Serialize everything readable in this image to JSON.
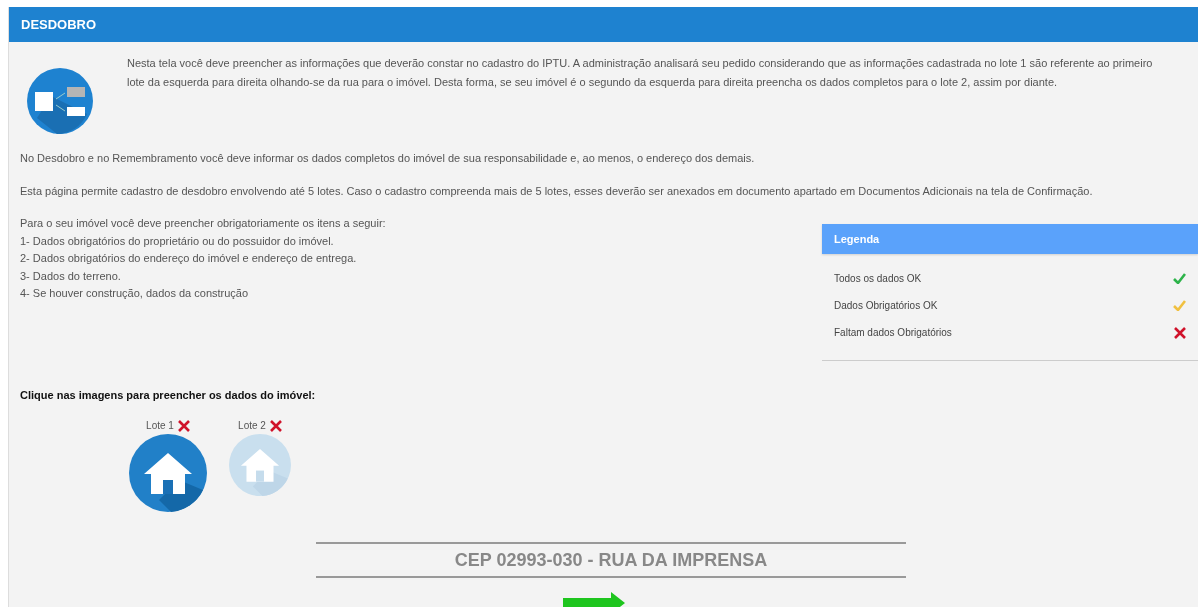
{
  "panel": {
    "title": "DESDOBRO"
  },
  "intro": "Nesta tela você deve preencher as informações que deverão constar no cadastro do IPTU. A administração analisará seu pedido considerando que as informações cadastrada no lote 1 são referente ao primeiro lote da esquerda para direita olhando-se da rua para o imóvel. Desta forma, se seu imóvel é o segundo da esquerda para direita preencha os dados completos para o lote 2, assim por diante.",
  "paragraphs": [
    "No Desdobro e no Remembramento você deve informar os dados completos do imóvel de sua responsabilidade e, ao menos, o endereço dos demais.",
    "Esta página permite cadastro de desdobro envolvendo até 5 lotes. Caso o cadastro compreenda mais de 5 lotes, esses deverão ser anexados em documento apartado em Documentos Adicionais na tela de Confirmação."
  ],
  "requirements": [
    "Para o seu imóvel você deve preencher obrigatoriamente os itens a seguir:",
    "1- Dados obrigatórios do proprietário ou do possuidor do imóvel.",
    "2- Dados obrigatórios do endereço do imóvel e endereço de entrega.",
    "3- Dados do terreno.",
    "4- Se houver construção, dados da construção"
  ],
  "legend": {
    "title": "Legenda",
    "items": [
      {
        "label": "Todos os dados OK",
        "kind": "ok"
      },
      {
        "label": "Dados Obrigatórios OK",
        "kind": "partial"
      },
      {
        "label": "Faltam dados Obrigatórios",
        "kind": "missing"
      }
    ]
  },
  "lots_prompt": "Clique nas imagens para preencher os dados do imóvel:",
  "lots": [
    {
      "label": "Lote 1",
      "kind": "missing",
      "selected": true
    },
    {
      "label": "Lote 2",
      "kind": "missing",
      "selected": false
    }
  ],
  "street": "CEP 02993-030 - RUA DA IMPRENSA"
}
